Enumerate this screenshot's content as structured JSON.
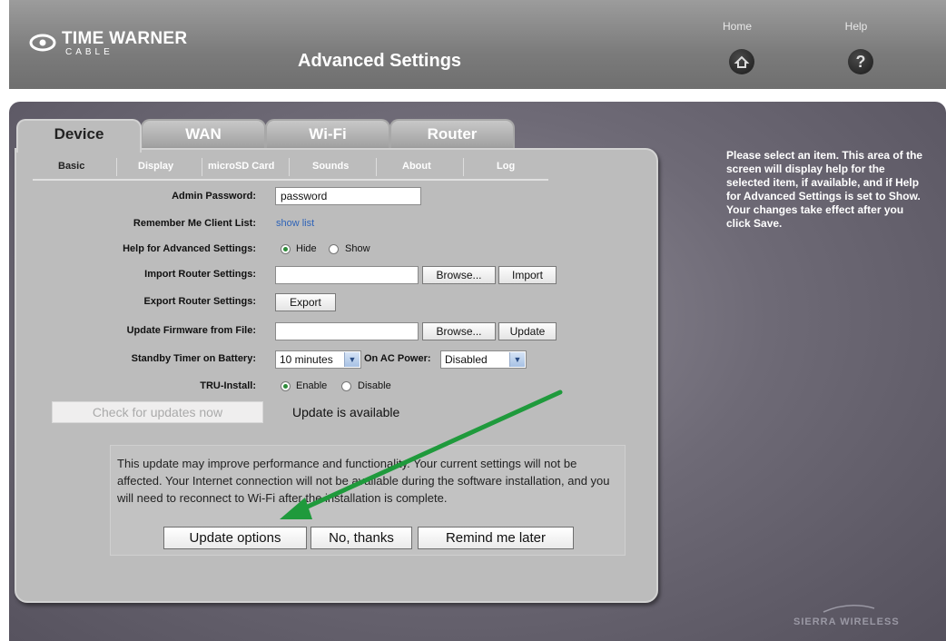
{
  "header": {
    "logo_name": "TIME WARNER",
    "logo_sub": "CABLE",
    "title": "Advanced Settings",
    "home_label": "Home",
    "help_label": "Help",
    "help_icon": "?"
  },
  "tabs": [
    {
      "label": "Device"
    },
    {
      "label": "WAN"
    },
    {
      "label": "Wi-Fi"
    },
    {
      "label": "Router"
    }
  ],
  "subtabs": [
    {
      "label": "Basic"
    },
    {
      "label": "Display"
    },
    {
      "label": "microSD Card"
    },
    {
      "label": "Sounds"
    },
    {
      "label": "About"
    },
    {
      "label": "Log"
    }
  ],
  "form": {
    "admin_password_label": "Admin Password:",
    "admin_password_value": "password",
    "remember_label": "Remember Me Client List:",
    "remember_link": "show list",
    "help_label": "Help for Advanced Settings:",
    "help_hide": "Hide",
    "help_show": "Show",
    "import_label": "Import Router Settings:",
    "browse": "Browse...",
    "import": "Import",
    "export_label": "Export Router Settings:",
    "export": "Export",
    "firmware_label": "Update Firmware from File:",
    "update": "Update",
    "standby_label": "Standby Timer on Battery:",
    "standby_value": "10 minutes",
    "ac_label": "On AC Power:",
    "ac_value": "Disabled",
    "tru_label": "TRU-Install:",
    "tru_enable": "Enable",
    "tru_disable": "Disable",
    "check_updates": "Check for updates now",
    "update_available": "Update is available"
  },
  "notice": {
    "text": "This update may improve performance and functionality. Your current settings will not be affected. Your Internet connection will not be available during the software installation, and you will need to reconnect to Wi-Fi after the installation is complete.",
    "update_options": "Update options",
    "no_thanks": "No, thanks",
    "remind_later": "Remind me later"
  },
  "help_panel": {
    "line1": "Please select an item. This area of the screen will display help for the selected item, if available, and if Help for Advanced Settings is set to Show.",
    "line2": "Your changes take effect after you click Save."
  },
  "footer": {
    "brand": "SIERRA WIRELESS"
  },
  "colors": {
    "arrow": "#1f9a3c",
    "link": "#2e63b8"
  }
}
